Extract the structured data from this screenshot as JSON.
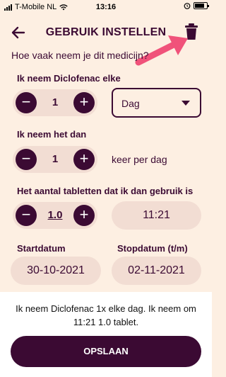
{
  "status_bar": {
    "carrier": "T-Mobile NL",
    "time": "13:16"
  },
  "header": {
    "title": "GEBRUIK INSTELLEN"
  },
  "question": "Hoe vaak neem je dit medicijn?",
  "frequency": {
    "label": "Ik neem Diclofenac elke",
    "value": "1",
    "unit_selected": "Dag"
  },
  "times_per_day": {
    "label": "Ik neem het dan",
    "value": "1",
    "suffix": "keer per dag"
  },
  "tablets": {
    "label": "Het aantal tabletten dat ik dan gebruik is",
    "value": "1.0",
    "time": "11:21"
  },
  "dates": {
    "start_label": "Startdatum",
    "start_value": "30-10-2021",
    "stop_label": "Stopdatum (t/m)",
    "stop_value": "02-11-2021"
  },
  "footer": {
    "summary": "Ik neem Diclofenac 1x elke dag. Ik neem om 11:21 1.0 tablet.",
    "save_label": "OPSLAAN"
  },
  "colors": {
    "primary": "#3b0a33",
    "background": "#fdefe2",
    "pill": "#f2ddd3",
    "arrow": "#f0527a"
  }
}
